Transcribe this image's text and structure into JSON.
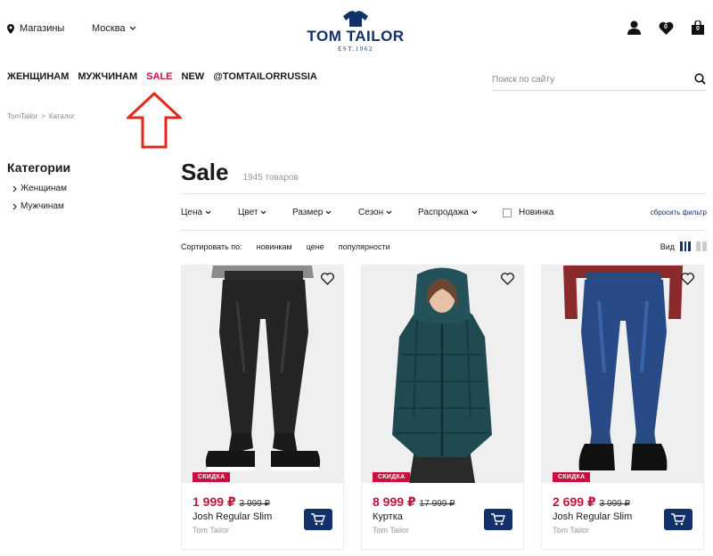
{
  "header": {
    "stores_label": "Магазины",
    "city_label": "Москва",
    "logo_text": "TOM TAILOR",
    "logo_sub": "EST.1962",
    "wishlist_count": "0",
    "cart_count": "0"
  },
  "nav": {
    "women": "ЖЕНЩИНАМ",
    "men": "МУЖЧИНАМ",
    "sale": "SALE",
    "new": "NEW",
    "social": "@TOMTAILORRUSSIA"
  },
  "search": {
    "placeholder": "Поиск по сайту"
  },
  "breadcrumb": {
    "home": "TomTailor",
    "sep": ">",
    "current": "Каталог"
  },
  "sidebar": {
    "title": "Категории",
    "items": [
      {
        "label": "Женщинам"
      },
      {
        "label": "Мужчинам"
      }
    ]
  },
  "catalog": {
    "title": "Sale",
    "count": "1945 товаров"
  },
  "filters": {
    "price": "Цена",
    "color": "Цвет",
    "size": "Размер",
    "season": "Сезон",
    "sale": "Распродажа",
    "novelty": "Новинка",
    "reset": "сбросить фильтр"
  },
  "sort": {
    "label": "Сортировать по:",
    "options": [
      "новинкам",
      "цене",
      "популярности"
    ],
    "view_label": "Вид"
  },
  "products": [
    {
      "badge": "СКИДКА",
      "price": "1 999 ₽",
      "old_price": "3 999 ₽",
      "name": "Josh Regular Slim",
      "brand": "Tom Tailor"
    },
    {
      "badge": "СКИДКА",
      "price": "8 999 ₽",
      "old_price": "17 999 ₽",
      "name": "Куртка",
      "brand": "Tom Tailor"
    },
    {
      "badge": "СКИДКА",
      "price": "2 699 ₽",
      "old_price": "3 999 ₽",
      "name": "Josh Regular Slim",
      "brand": "Tom Tailor"
    }
  ],
  "colors": {
    "brand_navy": "#12306a",
    "sale_red": "#c8103e",
    "annotation_red": "#e0281b"
  }
}
